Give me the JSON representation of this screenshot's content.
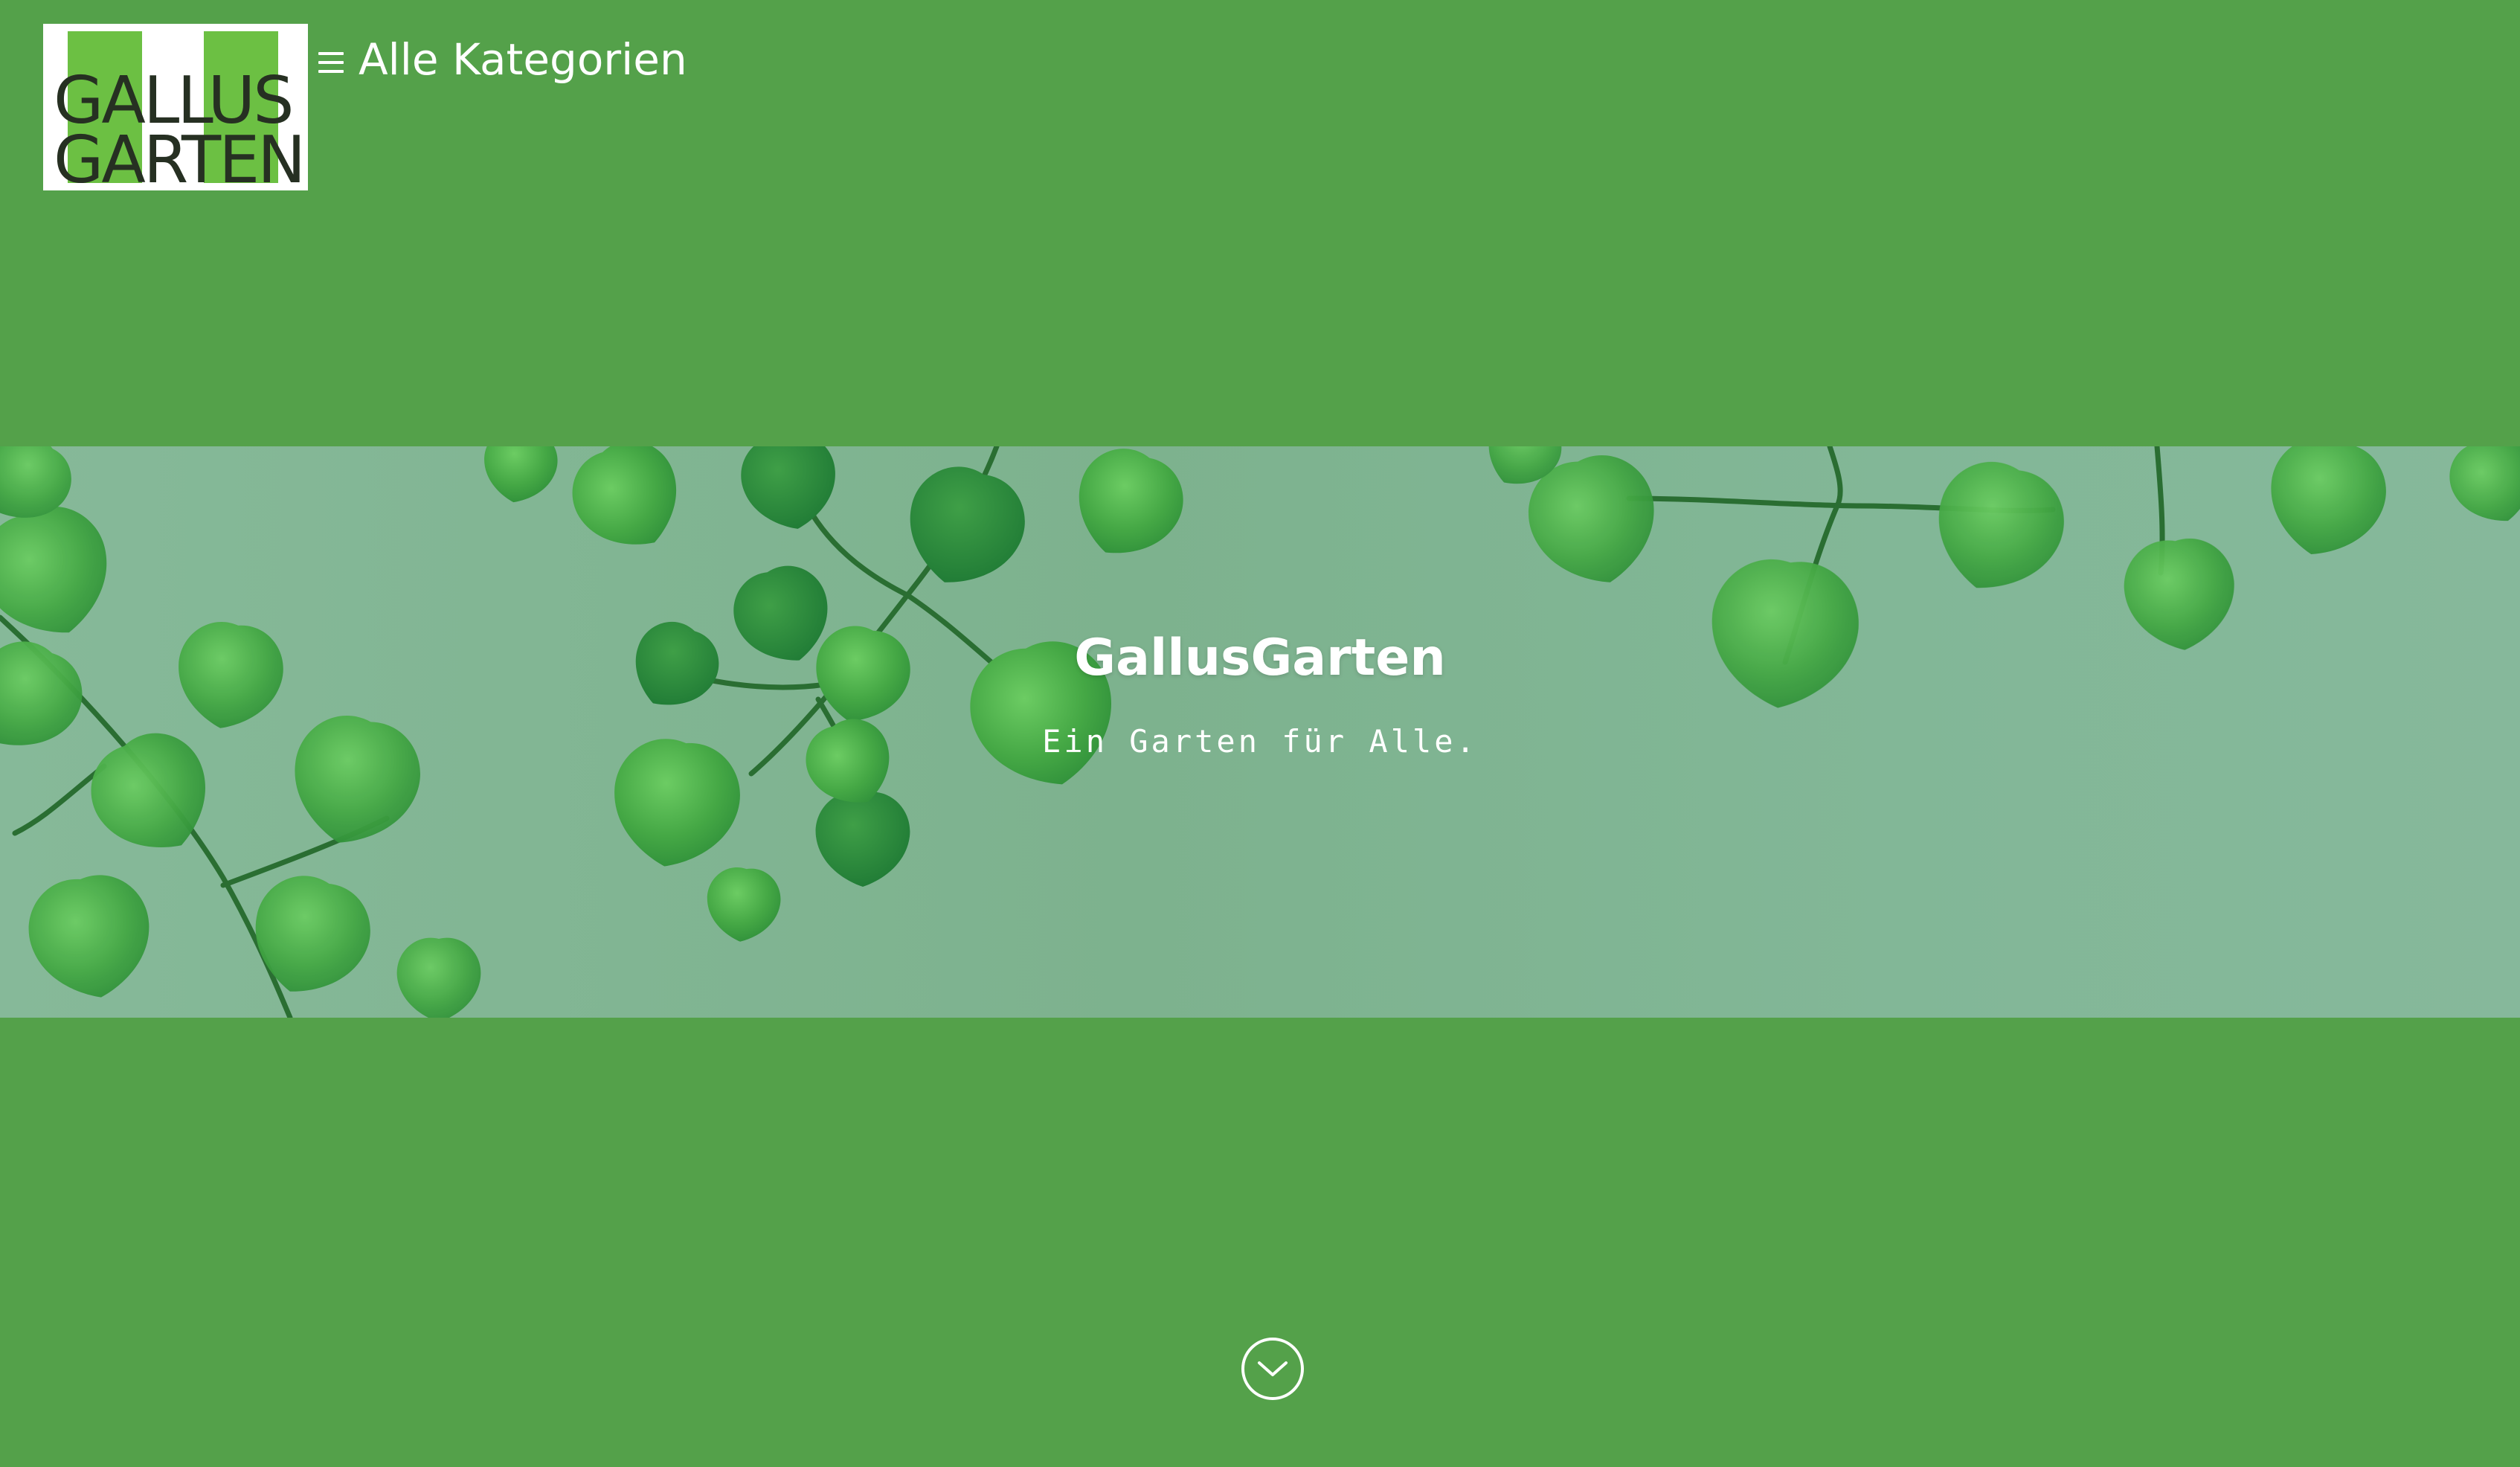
{
  "header": {
    "logo": {
      "line1": "GALLUS",
      "line2": "GARTEN"
    },
    "menu_label": "Alle Kategorien",
    "menu_icon": "hamburger-icon"
  },
  "hero": {
    "title": "GallusGarten",
    "subtitle": "Ein Garten für Alle.",
    "image": "green-leaves-image"
  },
  "scroll_down": {
    "icon": "chevron-down-circle-icon"
  },
  "colors": {
    "page_background": "#54a14a",
    "logo_accent": "#6cc043",
    "logo_text": "#263022",
    "hero_background": "#80b592",
    "text": "#ffffff"
  }
}
